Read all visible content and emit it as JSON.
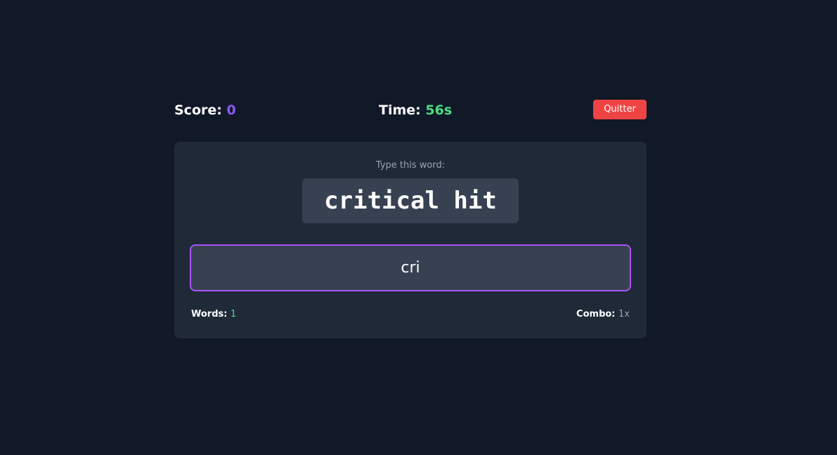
{
  "header": {
    "score_label": "Score:",
    "score_value": "0",
    "time_label": "Time:",
    "time_value": "56s",
    "quit_label": "Quitter"
  },
  "panel": {
    "prompt": "Type this word:",
    "target_word": "critical hit",
    "input_value": "cri",
    "words_label": "Words:",
    "words_value": "1",
    "combo_label": "Combo:",
    "combo_value": "1x"
  },
  "colors": {
    "background": "#111827",
    "panel": "#1f2937",
    "score_accent": "#8b5cf6",
    "time_accent": "#4ade80",
    "quit_button": "#ef4444",
    "input_border": "#a855f7"
  }
}
